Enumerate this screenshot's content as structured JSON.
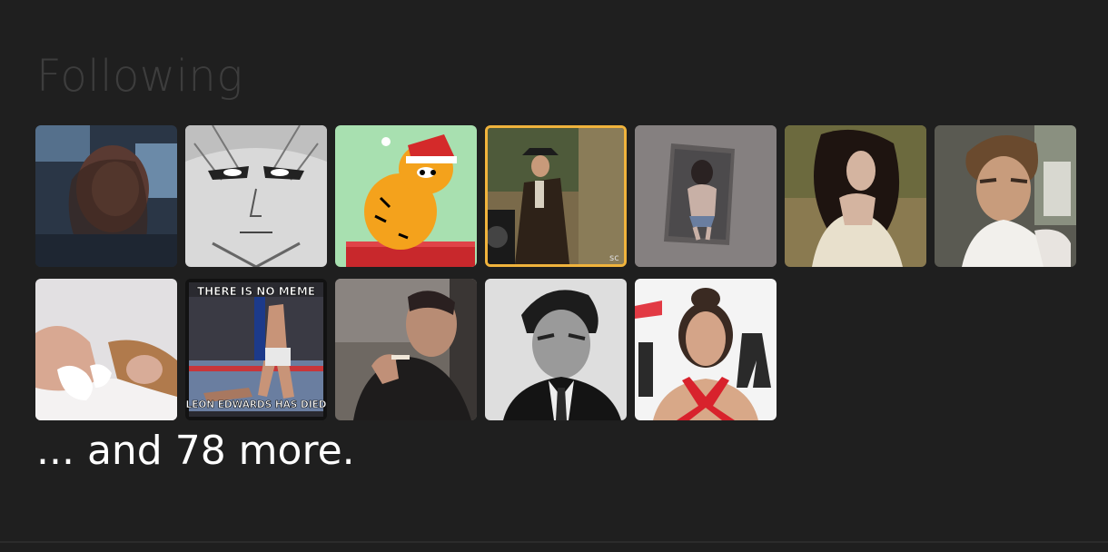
{
  "following": {
    "title": "Following",
    "more_text": "... and 78 more.",
    "accent_color": "#f0b33c",
    "avatars": [
      {
        "icon": "avatar-girl-dark-room"
      },
      {
        "icon": "avatar-manga-face"
      },
      {
        "icon": "avatar-garfield-santa"
      },
      {
        "icon": "avatar-godfather-scene",
        "highlighted": true
      },
      {
        "icon": "avatar-poster-on-wall"
      },
      {
        "icon": "avatar-woman-dark-hair"
      },
      {
        "icon": "avatar-young-man-portrait"
      },
      {
        "icon": "avatar-woman-lying"
      },
      {
        "icon": "avatar-meme-ufc",
        "top_text": "THERE IS NO MEME",
        "bottom_text": "LEON EDWARDS HAS DIED"
      },
      {
        "icon": "avatar-man-with-cigar"
      },
      {
        "icon": "avatar-man-black-white"
      },
      {
        "icon": "avatar-woman-red-dress"
      }
    ]
  }
}
